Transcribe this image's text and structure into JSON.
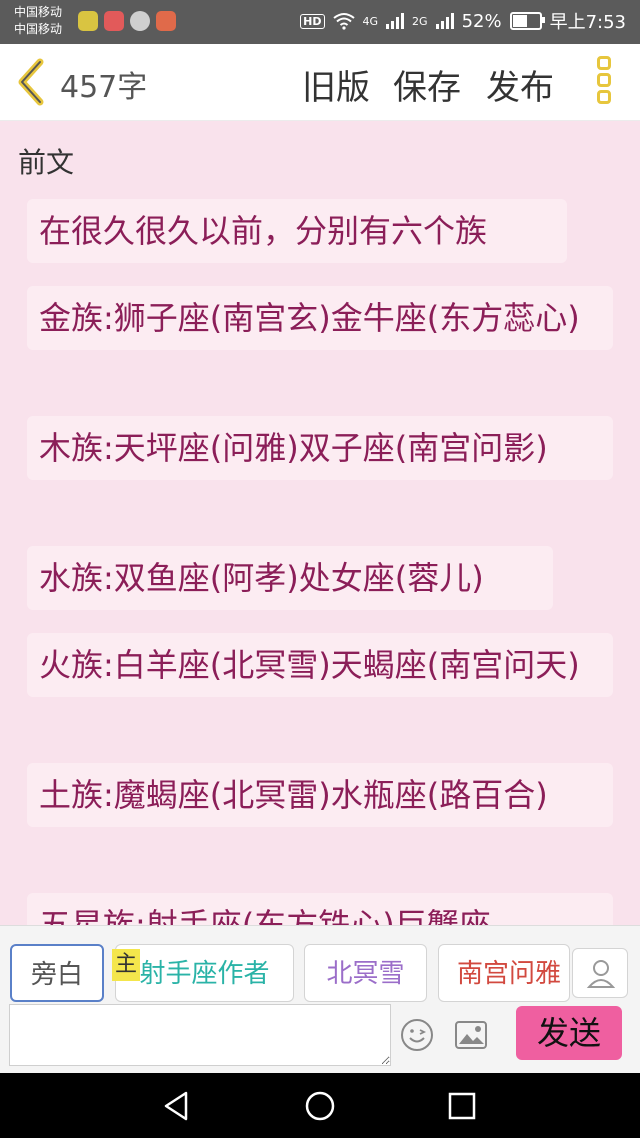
{
  "status_bar": {
    "carrier1": "中国移动",
    "carrier2": "中国移动",
    "hd": "HD",
    "signal1": "4G",
    "signal2": "2G",
    "battery": "52%",
    "battery_level": 0.52,
    "time": "早上7:53"
  },
  "toolbar": {
    "word_count": "457字",
    "old_version": "旧版",
    "save": "保存",
    "publish": "发布"
  },
  "content": {
    "section_title": "前文",
    "paragraphs": [
      "在很久很久以前，分别有六个族",
      "金族:狮子座(南宫玄)金牛座(东方蕊心)",
      "木族:天坪座(问雅)双子座(南宫问影)",
      "水族:双鱼座(阿孝)处女座(蓉儿)",
      "火族:白羊座(北冥雪)天蝎座(南宫问天)",
      "土族:魔蝎座(北冥雷)水瓶座(路百合)",
      "五星族:射手座(东方铁心)巨蟹座"
    ]
  },
  "composer": {
    "chips": [
      {
        "label": "旁白",
        "color": "#555555"
      },
      {
        "label": "射手座作者",
        "color": "#2ab3a7"
      },
      {
        "label": "北冥雪",
        "color": "#9b6ec9"
      },
      {
        "label": "南宫问雅",
        "color": "#d2493f"
      }
    ],
    "host_badge": "主",
    "input_value": "",
    "send": "发送"
  },
  "colors": {
    "accent_pink": "#ef5fa0",
    "text_burgundy": "#8b1e58",
    "background": "#f9e2ec",
    "menu_yellow": "#e7c63d"
  },
  "icons": [
    "back-icon",
    "menu-icon",
    "user-icon",
    "emoji-icon",
    "image-icon",
    "nav-back-icon",
    "nav-home-icon",
    "nav-recents-icon"
  ]
}
